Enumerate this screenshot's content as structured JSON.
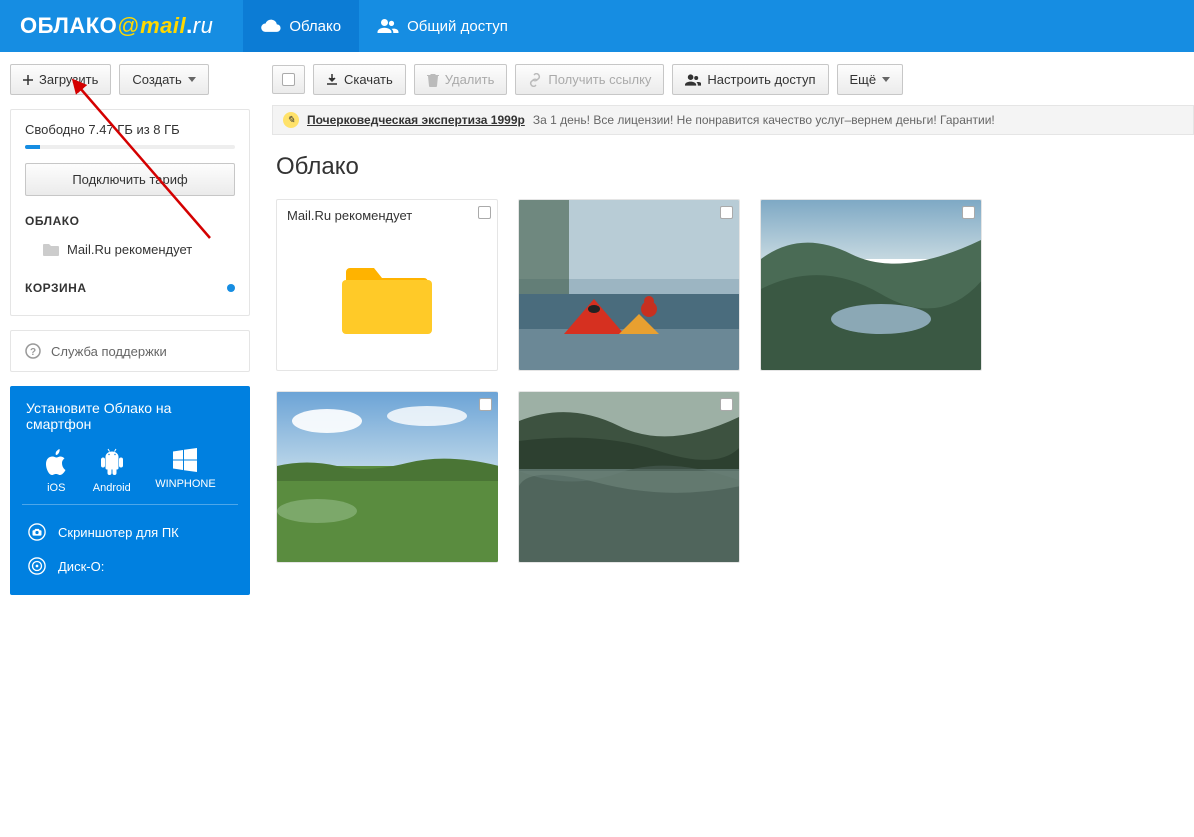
{
  "logo": {
    "oblako": "ОБЛАКО",
    "at": "@",
    "mail": "mail",
    "dot": ".",
    "ru": "ru"
  },
  "header_nav": {
    "cloud": "Облако",
    "shared": "Общий доступ"
  },
  "sidebar": {
    "upload_btn": "Загрузить",
    "create_btn": "Создать",
    "storage_text": "Свободно 7.47 ГБ из 8 ГБ",
    "connect_tariff": "Подключить тариф",
    "section_cloud": "ОБЛАКО",
    "tree_recommends": "Mail.Ru рекомендует",
    "section_trash": "КОРЗИНА",
    "support": "Служба поддержки",
    "promo_title": "Установите Облако на смартфон",
    "platforms": {
      "ios": "iOS",
      "android": "Android",
      "winphone": "WINPHONE"
    },
    "screenshoter": "Скриншотер для ПК",
    "disko": "Диск-О:"
  },
  "toolbar": {
    "download": "Скачать",
    "delete": "Удалить",
    "get_link": "Получить ссылку",
    "share": "Настроить доступ",
    "more": "Ещё"
  },
  "ad": {
    "link_text": "Почерковедческая экспертиза 1999р",
    "tail": "За 1 день! Все лицензии! Не понравится качество услуг–вернем деньги! Гарантии!"
  },
  "page_title": "Облако",
  "grid": {
    "folder_label": "Mail.Ru рекомендует"
  }
}
